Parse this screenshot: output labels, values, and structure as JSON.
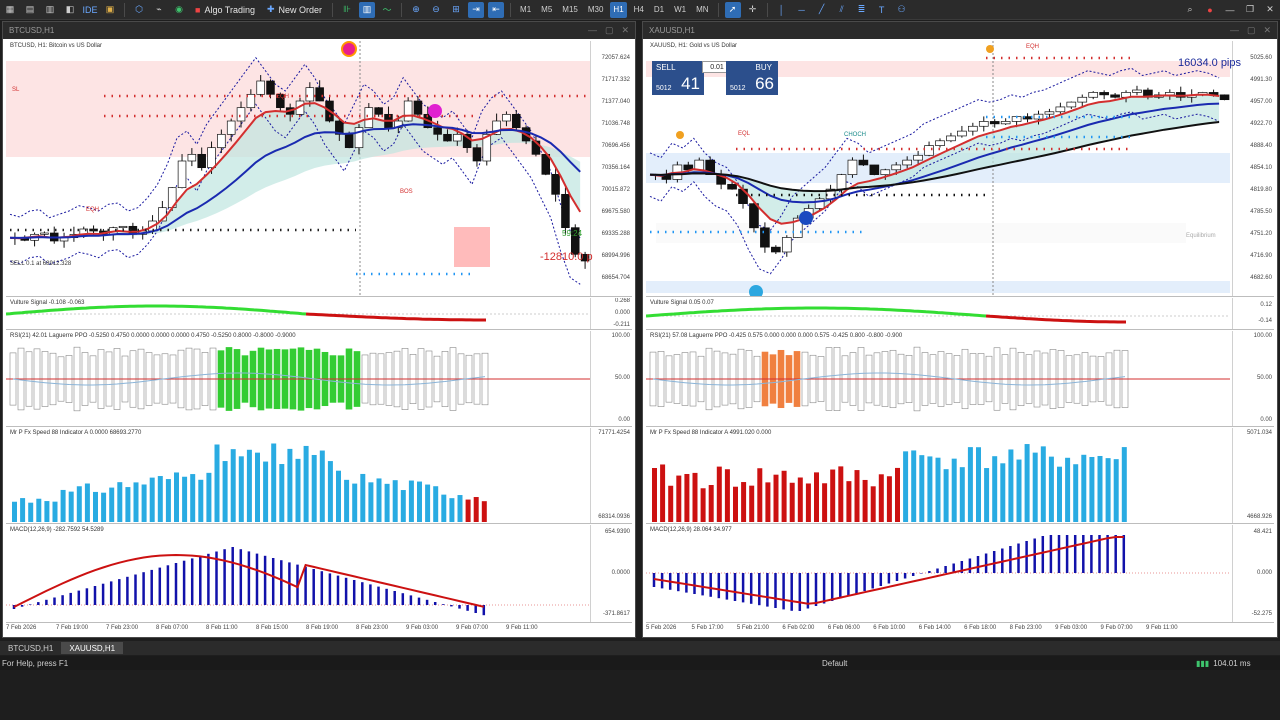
{
  "toolbar": {
    "algo_label": "Algo Trading",
    "new_order_label": "New Order",
    "timeframes": [
      "M1",
      "M5",
      "M15",
      "M30",
      "H1",
      "H4",
      "D1",
      "W1",
      "MN"
    ],
    "active_timeframe": "H1"
  },
  "left": {
    "title": "BTCUSD,H1",
    "label": "BTCUSD, H1:  Bitcoin vs US Dollar",
    "price_ticks": [
      "72057.624",
      "71717.332",
      "71377.040",
      "71036.748",
      "70696.456",
      "70356.164",
      "70015.872",
      "69675.580",
      "69335.288",
      "68994.996",
      "68654.704"
    ],
    "timer": "59:24",
    "pips": "-12810.0 p",
    "sell_label": "SELL 0.1 at 68912.328",
    "vulture_label": "Vulture Signal -0.108 -0.063",
    "vulture_ticks": [
      "0.268",
      "0.000",
      "-0.211"
    ],
    "rsi_label": "RSI(21) 42.01 Laguerre PPO -0.5250 0.4750 0.0000 0.0000 0.0000 0.4750 -0.5250 0.8000 -0.8000 -0.9000",
    "rsi_ticks": [
      "100.00",
      "50.00",
      "0.00"
    ],
    "speed_label": "Mr P Fx Speed 88 Indicator A 0.0000 68693.2770",
    "speed_ticks": [
      "71771.4254",
      "68314.0936"
    ],
    "macd_label": "MACD(12,26,9) -282.7592 54.5289",
    "macd_ticks": [
      "654.9390",
      "0.0000",
      "-371.8617"
    ],
    "dates": [
      "7 Feb 2026",
      "7 Feb 19:00",
      "7 Feb 23:00",
      "8 Feb 07:00",
      "8 Feb 11:00",
      "8 Feb 15:00",
      "8 Feb 19:00",
      "8 Feb 23:00",
      "9 Feb 03:00",
      "9 Feb 07:00",
      "9 Feb 11:00"
    ],
    "labels": {
      "eqh": "EQH",
      "bos": "BOS",
      "sl": "SL"
    }
  },
  "right": {
    "title": "XAUUSD,H1",
    "label": "XAUUSD, H1:  Gold vs US Dollar",
    "price_ticks": [
      "5025.60",
      "4991.30",
      "4957.00",
      "4922.70",
      "4888.40",
      "4854.10",
      "4819.80",
      "4785.50",
      "4751.20",
      "4716.90",
      "4682.60"
    ],
    "pips": "16034.0 pips",
    "vulture_label": "Vulture Signal 0.05 0.07",
    "vulture_ticks": [
      "0.12",
      "-0.14"
    ],
    "rsi_label": "RSI(21) 57.08 Laguerre PPO -0.425 0.575 0.000 0.000 0.000 0.575 -0.425 0.800 -0.800 -0.900",
    "rsi_ticks": [
      "100.00",
      "50.00",
      "0.00"
    ],
    "speed_label": "Mr P Fx Speed 88 Indicator A 4991.020 0.000",
    "speed_ticks": [
      "5071.034",
      "4668.926"
    ],
    "macd_label": "MACD(12,26,9) 28.064 34.977",
    "macd_ticks": [
      "48.421",
      "0.000",
      "-52.275"
    ],
    "dates": [
      "5 Feb 2026",
      "5 Feb 17:00",
      "5 Feb 21:00",
      "6 Feb 02:00",
      "6 Feb 06:00",
      "6 Feb 10:00",
      "6 Feb 14:00",
      "6 Feb 18:00",
      "8 Feb 23:00",
      "9 Feb 03:00",
      "9 Feb 07:00",
      "9 Feb 11:00"
    ],
    "trade": {
      "sell": "SELL",
      "buy": "BUY",
      "lot": "0.01",
      "sell_pre": "5012",
      "sell_big": "41",
      "buy_pre": "5012",
      "buy_big": "66"
    },
    "labels": {
      "eqh": "EQH",
      "eql": "EQL",
      "choch": "CHOCH",
      "equilibrium": "Equilibrium"
    }
  },
  "tabs": [
    "BTCUSD,H1",
    "XAUUSD,H1"
  ],
  "status": {
    "help": "For Help, press F1",
    "profile": "Default",
    "ping": "104.01 ms"
  },
  "colors": {
    "up": "#2196f3",
    "down": "#d32f2f",
    "green": "#33dd33",
    "bull_bar": "#29abe2",
    "bear_bar": "#cc1111",
    "macd": "#1111aa",
    "zone_red": "#fde4e4",
    "zone_blue": "#e3eefb"
  }
}
